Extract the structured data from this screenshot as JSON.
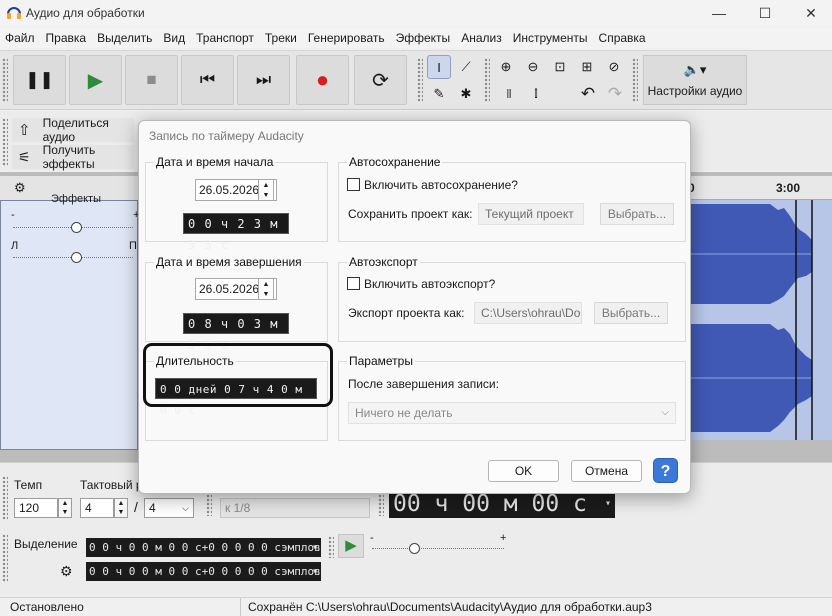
{
  "window": {
    "title": "Аудио для обработки",
    "minimize": "—",
    "maximize": "☐",
    "close": "✕"
  },
  "menu": [
    "Файл",
    "Правка",
    "Выделить",
    "Вид",
    "Транспорт",
    "Треки",
    "Генерировать",
    "Эффекты",
    "Анализ",
    "Инструменты",
    "Справка"
  ],
  "toolbar": {
    "pause": "❚❚",
    "play": "▶",
    "stop": "■",
    "skip_start": "⏮",
    "skip_end": "⏭",
    "record": "●",
    "loop": "⟳",
    "audio_settings_icon": "🔈▾",
    "audio_settings": "Настройки аудио",
    "tools": [
      "I",
      "⟋",
      "✎",
      "✱"
    ],
    "zoom": [
      "⊕",
      "⊖",
      "⊡",
      "⊞",
      "⊘"
    ],
    "undo": "↶",
    "redo": "↷"
  },
  "share": {
    "share_audio": "Поделиться аудио",
    "get_effects": "Получить эффекты"
  },
  "ruler": {
    "mark_3": "3:00"
  },
  "track": {
    "effects_label": "Эффекты",
    "gain_minus": "-",
    "gain_plus": "+",
    "pan_left": "Л",
    "pan_right": "П"
  },
  "bottom": {
    "tempo_label": "Темп",
    "tempo_value": "120",
    "meter_label": "Тактовый р",
    "meter_num": "4",
    "meter_slash": "/",
    "meter_den": "4",
    "snap": "к 1/8",
    "big_time": "00 ч 00 м 00 с",
    "selection_label": "Выделение",
    "sel_start": "0 0 ч 0 0 м 0 0 с+0 0 0 0 0  сэмплов",
    "sel_end": "0 0 ч 0 0 м 0 0 с+0 0 0 0 0  сэмплов",
    "play_speed_minus": "-",
    "play_speed_plus": "+"
  },
  "status": {
    "left": "Остановлено",
    "right": "Сохранён C:\\Users\\ohrau\\Documents\\Audacity\\Аудио для обработки.aup3"
  },
  "dialog": {
    "title": "Запись по таймеру Audacity",
    "start": {
      "label": "Дата и время начала",
      "date": "26.05.2026",
      "time": "0 0 ч 2 3 м 3 3 с"
    },
    "end": {
      "label": "Дата и время завершения",
      "date": "26.05.2026",
      "time": "0 8 ч 0 3 м 3 3 с"
    },
    "duration": {
      "label": "Длительность",
      "value": "0 0 дней 0 7 ч 4 0 м 0 0 с"
    },
    "autosave": {
      "group": "Автосохранение",
      "enable": "Включить автосохранение?",
      "save_as_label": "Сохранить проект как:",
      "save_as_value": "Текущий проект",
      "choose": "Выбрать..."
    },
    "autoexport": {
      "group": "Автоэкспорт",
      "enable": "Включить автоэкспорт?",
      "export_as_label": "Экспорт проекта как:",
      "export_as_value": "C:\\Users\\ohrau\\Do",
      "choose": "Выбрать..."
    },
    "params": {
      "group": "Параметры",
      "after_label": "После завершения записи:",
      "after_value": "Ничего не делать"
    },
    "ok": "OK",
    "cancel": "Отмена",
    "help": "?"
  },
  "colors": {
    "accent_green": "#2e8b3a",
    "record_red": "#d42020",
    "help_blue": "#3b78d8",
    "wave": "#3f59b5",
    "highlight_box": "#111111"
  }
}
